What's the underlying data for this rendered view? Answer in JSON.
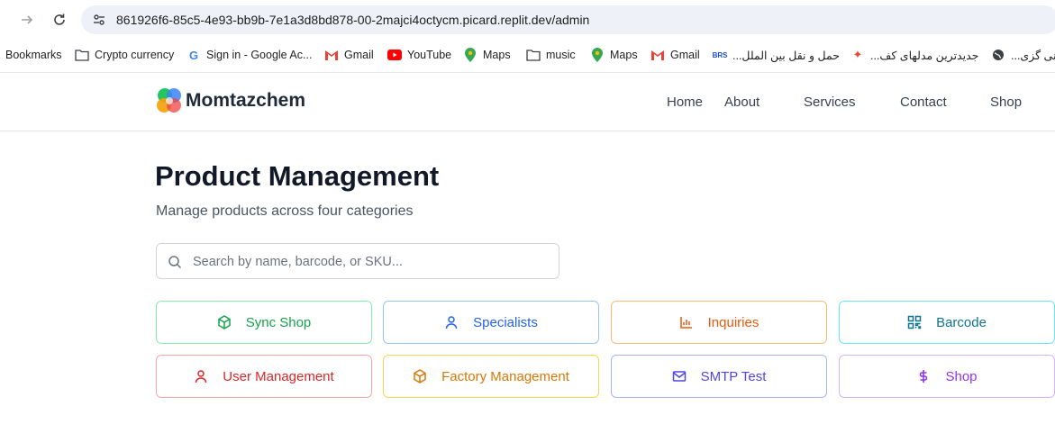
{
  "browser": {
    "url": "861926f6-85c5-4e93-bb9b-7e1a3d8bd878-00-2majci4octycm.picard.replit.dev/admin",
    "bookmarks": [
      {
        "label": "Bookmarks",
        "icon": "none"
      },
      {
        "label": "Crypto currency",
        "icon": "folder-icon"
      },
      {
        "label": "Sign in - Google Ac...",
        "icon": "google-icon"
      },
      {
        "label": "Gmail",
        "icon": "gmail-icon"
      },
      {
        "label": "YouTube",
        "icon": "youtube-icon"
      },
      {
        "label": "Maps",
        "icon": "maps-icon"
      },
      {
        "label": "music",
        "icon": "folder-icon"
      },
      {
        "label": "Maps",
        "icon": "maps-icon"
      },
      {
        "label": "Gmail",
        "icon": "gmail-icon"
      },
      {
        "label": "حمل و نقل بین الملل...",
        "icon": "brs-icon"
      },
      {
        "label": "جدیدترین مدلهای کف...",
        "icon": "sparkle-icon"
      },
      {
        "label": "نی گزی...",
        "icon": "globe-icon"
      }
    ]
  },
  "header": {
    "brand": "Momtazchem",
    "nav": [
      "Home",
      "About",
      "Services",
      "Contact",
      "Shop"
    ]
  },
  "main": {
    "title": "Product Management",
    "subtitle": "Manage products across four categories",
    "search_placeholder": "Search by name, barcode, or SKU...",
    "tiles": [
      {
        "label": "Sync Shop",
        "icon": "package-icon",
        "color": "#16a34a",
        "border": "#86efac"
      },
      {
        "label": "Specialists",
        "icon": "user-icon",
        "color": "#2563eb",
        "border": "#93c5fd"
      },
      {
        "label": "Inquiries",
        "icon": "bar-chart-icon",
        "color": "#ea580c",
        "border": "#fdba74"
      },
      {
        "label": "Barcode",
        "icon": "qr-code-icon",
        "color": "#0e7490",
        "border": "#67e8f9"
      },
      {
        "label": "User Management",
        "icon": "user-icon",
        "color": "#dc2626",
        "border": "#fca5a5"
      },
      {
        "label": "Factory Management",
        "icon": "package-icon",
        "color": "#d97706",
        "border": "#fcd34d"
      },
      {
        "label": "SMTP Test",
        "icon": "mail-icon",
        "color": "#4f46e5",
        "border": "#a5b4fc"
      },
      {
        "label": "Shop",
        "icon": "dollar-icon",
        "color": "#9333ea",
        "border": "#d8b4fe"
      }
    ]
  }
}
